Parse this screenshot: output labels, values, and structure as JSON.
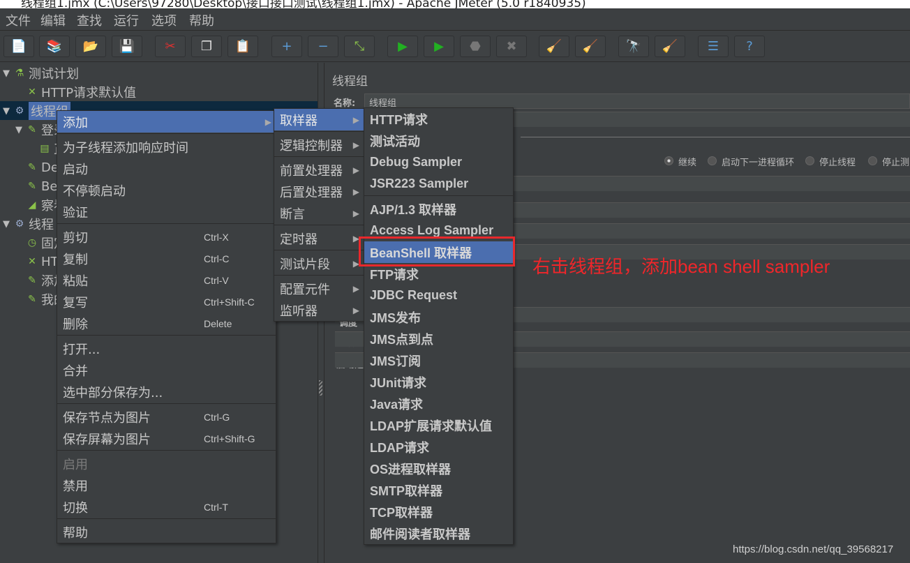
{
  "window": {
    "title": "线程组1.jmx (C:\\Users\\97280\\Desktop\\接口接口测试\\线程组1.jmx) - Apache JMeter (5.0 r1840935)"
  },
  "menubar": [
    "文件",
    "编辑",
    "查找",
    "运行",
    "选项",
    "帮助"
  ],
  "toolbar": [
    {
      "icon": "new-icon",
      "glyph": "📄",
      "color": "#ffffff"
    },
    {
      "icon": "templates-icon",
      "glyph": "📚",
      "color": "#4caf50"
    },
    {
      "icon": "open-icon",
      "glyph": "📂",
      "color": "#f0b030"
    },
    {
      "icon": "save-icon",
      "glyph": "💾",
      "color": "#dddddd"
    },
    {
      "icon": "cut-icon",
      "glyph": "✂",
      "color": "#e03030"
    },
    {
      "icon": "copy-icon",
      "glyph": "❐",
      "color": "#dddddd"
    },
    {
      "icon": "paste-icon",
      "glyph": "📋",
      "color": "#d9a050"
    },
    {
      "icon": "expand-icon",
      "glyph": "+",
      "color": "#5b9bd5"
    },
    {
      "icon": "collapse-icon",
      "glyph": "−",
      "color": "#5b9bd5"
    },
    {
      "icon": "toggle-icon",
      "glyph": "⤡",
      "color": "#8bc34a"
    },
    {
      "icon": "start-icon",
      "glyph": "▶",
      "color": "#22b022"
    },
    {
      "icon": "start-no-pause-icon",
      "glyph": "▶",
      "color": "#22b022"
    },
    {
      "icon": "stop-icon",
      "glyph": "⬣",
      "color": "#777777"
    },
    {
      "icon": "shutdown-icon",
      "glyph": "✖",
      "color": "#777777"
    },
    {
      "icon": "clear-icon",
      "glyph": "🧹",
      "color": "#c8a060"
    },
    {
      "icon": "clear-all-icon",
      "glyph": "🧹",
      "color": "#c8a060"
    },
    {
      "icon": "search-icon",
      "glyph": "🔭",
      "color": "#cccccc"
    },
    {
      "icon": "reset-search-icon",
      "glyph": "🧹",
      "color": "#f0d020"
    },
    {
      "icon": "function-helper-icon",
      "glyph": "☰",
      "color": "#5b9bd5"
    },
    {
      "icon": "help-icon",
      "glyph": "?",
      "color": "#5b9bd5"
    }
  ],
  "tree": [
    {
      "label": "测试计划",
      "icon": "test-plan-icon",
      "glyph": "⚗",
      "arrow": "▼",
      "indent": 0
    },
    {
      "label": "HTTP请求默认值",
      "icon": "config-icon",
      "glyph": "✕",
      "arrow": "",
      "indent": 1
    },
    {
      "label": "线程组",
      "icon": "thread-group-icon",
      "glyph": "⚙",
      "arrow": "▼",
      "indent": 0,
      "selected": true
    },
    {
      "label": "登录",
      "icon": "sampler-icon",
      "glyph": "✎",
      "arrow": "▼",
      "indent": 1
    },
    {
      "label": "正",
      "icon": "extractor-icon",
      "glyph": "▤",
      "arrow": "",
      "indent": 2
    },
    {
      "label": "De",
      "icon": "sampler-icon",
      "glyph": "✎",
      "arrow": "",
      "indent": 1
    },
    {
      "label": "Bea",
      "icon": "sampler-icon",
      "glyph": "✎",
      "arrow": "",
      "indent": 1
    },
    {
      "label": "察看",
      "icon": "listener-icon",
      "glyph": "◢",
      "arrow": "",
      "indent": 1
    },
    {
      "label": "线程",
      "icon": "thread-group-icon",
      "glyph": "⚙",
      "arrow": "▼",
      "indent": 0
    },
    {
      "label": "固定",
      "icon": "timer-icon",
      "glyph": "◷",
      "arrow": "",
      "indent": 1
    },
    {
      "label": "HT",
      "icon": "config-icon",
      "glyph": "✕",
      "arrow": "",
      "indent": 1
    },
    {
      "label": "添加",
      "icon": "sampler-icon",
      "glyph": "✎",
      "arrow": "",
      "indent": 1
    },
    {
      "label": "我的",
      "icon": "sampler-icon",
      "glyph": "✎",
      "arrow": "",
      "indent": 1
    }
  ],
  "panel": {
    "title": "线程组",
    "name_label": "名称:",
    "name_value": "线程组",
    "radios": [
      {
        "label": "继续",
        "checked": true
      },
      {
        "label": "启动下一进程循环"
      },
      {
        "label": "停止线程"
      },
      {
        "label": "停止测"
      }
    ],
    "labels": [
      "调度",
      "持续时",
      "启动延"
    ]
  },
  "context_menu": [
    {
      "label": "添加",
      "submenu": true,
      "highlight": true
    },
    {
      "sep": true
    },
    {
      "label": "为子线程添加响应时间"
    },
    {
      "label": "启动"
    },
    {
      "label": "不停顿启动"
    },
    {
      "label": "验证"
    },
    {
      "sep": true
    },
    {
      "label": "剪切",
      "shortcut": "Ctrl-X"
    },
    {
      "label": "复制",
      "shortcut": "Ctrl-C"
    },
    {
      "label": "粘贴",
      "shortcut": "Ctrl-V"
    },
    {
      "label": "复写",
      "shortcut": "Ctrl+Shift-C"
    },
    {
      "label": "删除",
      "shortcut": "Delete"
    },
    {
      "sep": true
    },
    {
      "label": "打开..."
    },
    {
      "label": "合并"
    },
    {
      "label": "选中部分保存为..."
    },
    {
      "sep": true
    },
    {
      "label": "保存节点为图片",
      "shortcut": "Ctrl-G"
    },
    {
      "label": "保存屏幕为图片",
      "shortcut": "Ctrl+Shift-G"
    },
    {
      "sep": true
    },
    {
      "label": "启用",
      "disabled": true
    },
    {
      "label": "禁用"
    },
    {
      "label": "切换",
      "shortcut": "Ctrl-T"
    },
    {
      "sep": true
    },
    {
      "label": "帮助"
    }
  ],
  "add_submenu": [
    {
      "label": "取样器",
      "submenu": true,
      "highlight": true
    },
    {
      "sep": true
    },
    {
      "label": "逻辑控制器",
      "submenu": true
    },
    {
      "sep": true
    },
    {
      "label": "前置处理器",
      "submenu": true
    },
    {
      "label": "后置处理器",
      "submenu": true
    },
    {
      "label": "断言",
      "submenu": true
    },
    {
      "sep": true
    },
    {
      "label": "定时器",
      "submenu": true
    },
    {
      "sep": true
    },
    {
      "label": "测试片段",
      "submenu": true
    },
    {
      "sep": true
    },
    {
      "label": "配置元件",
      "submenu": true
    },
    {
      "label": "监听器",
      "submenu": true
    }
  ],
  "sampler_submenu": [
    {
      "label": "HTTP请求"
    },
    {
      "label": "测试活动"
    },
    {
      "label": "Debug Sampler"
    },
    {
      "label": "JSR223 Sampler"
    },
    {
      "sep": true
    },
    {
      "label": "AJP/1.3 取样器"
    },
    {
      "label": "Access Log Sampler"
    },
    {
      "label": "BeanShell 取样器",
      "highlight": true
    },
    {
      "label": "FTP请求"
    },
    {
      "label": "JDBC Request"
    },
    {
      "label": "JMS发布"
    },
    {
      "label": "JMS点到点"
    },
    {
      "label": "JMS订阅"
    },
    {
      "label": "JUnit请求"
    },
    {
      "label": "Java请求"
    },
    {
      "label": "LDAP扩展请求默认值"
    },
    {
      "label": "LDAP请求"
    },
    {
      "label": "OS进程取样器"
    },
    {
      "label": "SMTP取样器"
    },
    {
      "label": "TCP取样器"
    },
    {
      "label": "邮件阅读者取样器"
    }
  ],
  "annotation": "右击线程组，添加bean shell sampler",
  "watermark": "https://blog.csdn.net/qq_39568217",
  "colors": {
    "highlight": "#4b6eaf",
    "annotation": "#f0262a",
    "background": "#3c3f41"
  }
}
